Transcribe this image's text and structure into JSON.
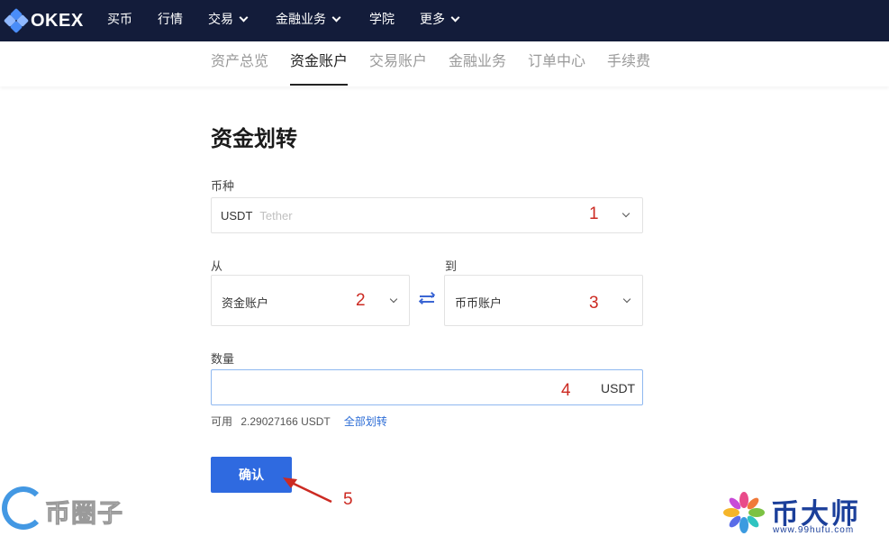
{
  "brand": {
    "logo_text": "OKEX"
  },
  "topnav": {
    "items": [
      {
        "label": "买币",
        "dropdown": false
      },
      {
        "label": "行情",
        "dropdown": false
      },
      {
        "label": "交易",
        "dropdown": true
      },
      {
        "label": "金融业务",
        "dropdown": true
      },
      {
        "label": "学院",
        "dropdown": false
      },
      {
        "label": "更多",
        "dropdown": true
      }
    ]
  },
  "subnav": {
    "tabs": [
      "资产总览",
      "资金账户",
      "交易账户",
      "金融业务",
      "订单中心",
      "手续费"
    ],
    "active_index": 1
  },
  "form": {
    "title": "资金划转",
    "currency_label": "币种",
    "currency_value": "USDT",
    "currency_placeholder": "Tether",
    "from_label": "从",
    "from_value": "资金账户",
    "to_label": "到",
    "to_value": "币币账户",
    "amount_label": "数量",
    "amount_unit": "USDT",
    "available_label": "可用",
    "available_value": "2.29027166 USDT",
    "transfer_all_label": "全部划转",
    "confirm_label": "确认"
  },
  "annotations": {
    "n1": "1",
    "n2": "2",
    "n3": "3",
    "n4": "4",
    "n5": "5"
  },
  "watermarks": {
    "left_text": "币圈子",
    "right_text": "币大师",
    "right_url": "www.99hufu.com"
  },
  "colors": {
    "topbar": "#131c3a",
    "accent": "#2f6ae0",
    "annotation": "#cc2a22"
  }
}
